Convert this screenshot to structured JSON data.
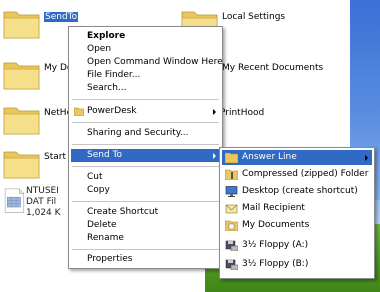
{
  "explorer": {
    "items": [
      {
        "label": "SendTo",
        "selected": true
      },
      {
        "label": "Local Settings"
      },
      {
        "label": "My Doc"
      },
      {
        "label": "My Recent Documents"
      },
      {
        "label": "NetHoo"
      },
      {
        "label": "PrintHood"
      },
      {
        "label": "Start M"
      }
    ],
    "file": {
      "name": "NTUSEI",
      "type": "DAT Fil",
      "size": "1,024 K"
    }
  },
  "context_menu": {
    "items": [
      {
        "label": "Explore",
        "bold": true
      },
      {
        "label": "Open"
      },
      {
        "label": "Open Command Window Here"
      },
      {
        "label": "File Finder..."
      },
      {
        "label": "Search..."
      },
      {
        "label": "PowerDesk",
        "submenu": true
      },
      {
        "label": "Sharing and Security..."
      },
      {
        "label": "Send To",
        "submenu": true,
        "highlighted": true
      },
      {
        "label": "Cut"
      },
      {
        "label": "Copy"
      },
      {
        "label": "Create Shortcut"
      },
      {
        "label": "Delete"
      },
      {
        "label": "Rename"
      },
      {
        "label": "Properties"
      }
    ]
  },
  "send_to_menu": {
    "items": [
      {
        "label": "Answer Line",
        "icon": "folder-icon",
        "submenu": true,
        "highlighted": true
      },
      {
        "label": "Compressed (zipped) Folder",
        "icon": "zip-folder-icon"
      },
      {
        "label": "Desktop (create shortcut)",
        "icon": "desktop-icon"
      },
      {
        "label": "Mail Recipient",
        "icon": "mail-icon"
      },
      {
        "label": "My Documents",
        "icon": "documents-folder-icon"
      },
      {
        "label": "3½ Floppy (A:)",
        "icon": "floppy-drive-icon"
      },
      {
        "label": "3½ Floppy (B:)",
        "icon": "floppy-drive-icon"
      }
    ]
  },
  "colors": {
    "selection": "#316ac5",
    "folder": "#f4d97a"
  }
}
